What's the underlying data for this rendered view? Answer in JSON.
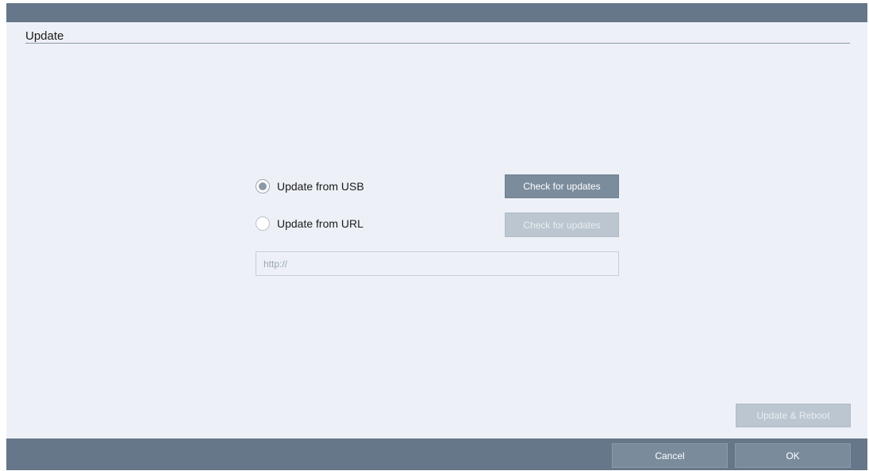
{
  "dialog": {
    "title": "Update"
  },
  "options": {
    "usb": {
      "label": "Update from USB",
      "checked": true,
      "check_button": "Check for updates"
    },
    "url": {
      "label": "Update from URL",
      "checked": false,
      "check_button": "Check for updates",
      "input_placeholder": "http://",
      "input_value": ""
    }
  },
  "actions": {
    "update_reboot": "Update & Reboot"
  },
  "footer": {
    "cancel": "Cancel",
    "ok": "OK"
  },
  "colors": {
    "bar": "#657789",
    "background": "#edf1f7",
    "button_active": "#7b8c9d",
    "button_disabled": "#bcc6d0"
  }
}
